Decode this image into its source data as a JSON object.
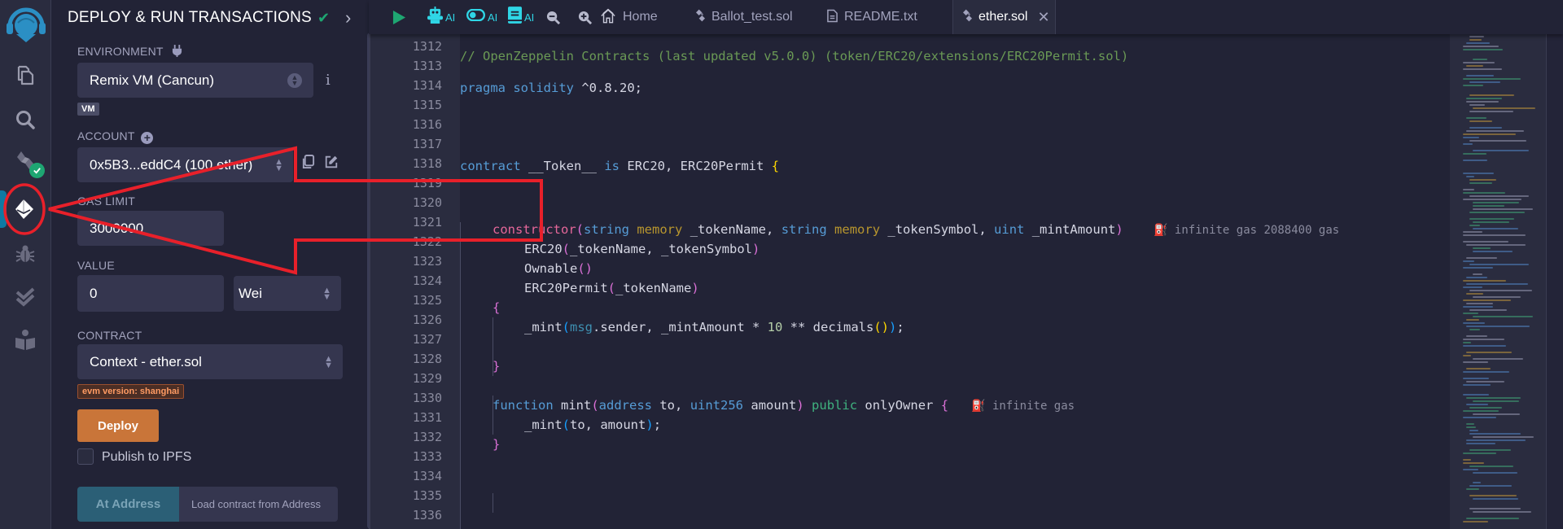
{
  "side_panel": {
    "title": "DEPLOY & RUN TRANSACTIONS",
    "environment": {
      "label": "ENVIRONMENT",
      "value": "Remix VM (Cancun)",
      "badge": "VM",
      "info": "i"
    },
    "account": {
      "label": "ACCOUNT",
      "value": "0x5B3...eddC4 (100 ether)"
    },
    "gas_limit": {
      "label": "GAS LIMIT",
      "value": "3000000"
    },
    "value": {
      "label": "VALUE",
      "amount": "0",
      "unit": "Wei"
    },
    "contract": {
      "label": "CONTRACT",
      "value": "Context - ether.sol",
      "evm_badge": "evm version: shanghai"
    },
    "deploy_label": "Deploy",
    "publish_ipfs_label": "Publish to IPFS",
    "publish_ipfs_checked": false,
    "at_address_label": "At Address",
    "at_address_placeholder": "Load contract from Address"
  },
  "icon_rail": {
    "items": [
      {
        "icon": "remix-logo-icon"
      },
      {
        "icon": "file-explorer-icon"
      },
      {
        "icon": "search-icon"
      },
      {
        "icon": "solidity-compiler-icon",
        "badge": "success-check"
      },
      {
        "icon": "deploy-run-icon",
        "active": true
      },
      {
        "icon": "debugger-icon"
      },
      {
        "icon": "testing-icon"
      },
      {
        "icon": "learneth-icon"
      }
    ]
  },
  "toolbar": {
    "run_icon": "play-icon",
    "ai_buttons": [
      {
        "icon": "robot-icon",
        "label": "AI"
      },
      {
        "icon": "toggle-icon",
        "label": "AI"
      },
      {
        "icon": "book-icon",
        "label": "AI"
      }
    ],
    "zoom_out_icon": "zoom-out-icon",
    "zoom_in_icon": "zoom-in-icon"
  },
  "tabs": [
    {
      "label": "Home",
      "icon": "home-icon",
      "active": false
    },
    {
      "label": "Ballot_test.sol",
      "icon": "solidity-file-icon",
      "active": false
    },
    {
      "label": "README.txt",
      "icon": "text-file-icon",
      "active": false
    },
    {
      "label": "ether.sol",
      "icon": "solidity-file-icon",
      "active": true,
      "closable": true
    }
  ],
  "editor": {
    "line_numbers": [
      "1312",
      "1313",
      "1314",
      "1315",
      "1316",
      "1317",
      "1318",
      "1319",
      "1320",
      "1321",
      "1322",
      "1323",
      "1324",
      "1325",
      "1326",
      "1327",
      "1328",
      "1329",
      "1330",
      "1331",
      "1332",
      "1333",
      "1334",
      "1335",
      "1336"
    ],
    "lines": {
      "l1313_comment": "// OpenZeppelin Contracts (last updated v5.0.0) (token/ERC20/extensions/ERC20Permit.sol)",
      "l1315_pragma": "pragma",
      "l1315_solidity": "solidity",
      "l1315_version": "^0.8.20;",
      "l1320_contract": "contract",
      "l1320_name": "__Token__",
      "l1320_is": "is",
      "l1320_bases": "ERC20, ERC20Permit",
      "l1320_brace": "{",
      "l1324_ctor": "constructor",
      "l1324_p_open": "(",
      "l1324_string1": "string",
      "l1324_memory1": "memory",
      "l1324_arg1": "_tokenName,",
      "l1324_string2": "string",
      "l1324_memory2": "memory",
      "l1324_arg2": "_tokenSymbol,",
      "l1324_uint": "uint",
      "l1324_arg3": "_mintAmount",
      "l1324_p_close": ")",
      "l1324_gas": "infinite gas 2088400 gas",
      "l1325_a": "ERC20",
      "l1325_b": "(",
      "l1325_c": "_tokenName, _tokenSymbol",
      "l1325_d": ")",
      "l1326_a": "Ownable",
      "l1326_b": "()",
      "l1327_a": "ERC20Permit",
      "l1327_b": "(",
      "l1327_c": "_tokenName",
      "l1327_d": ")",
      "l1328": "{",
      "l1329_a": "_mint",
      "l1329_b": "(",
      "l1329_msg": "msg",
      "l1329_c": ".sender, _mintAmount * ",
      "l1329_num": "10",
      "l1329_d": " ** decimals",
      "l1329_e": "()",
      "l1329_f": ")",
      "l1329_g": ";",
      "l1331": "}",
      "l1333_function": "function",
      "l1333_name": "mint",
      "l1333_p_open": "(",
      "l1333_address": "address",
      "l1333_to": "to,",
      "l1333_uint256": "uint256",
      "l1333_amount": "amount",
      "l1333_p_close": ")",
      "l1333_public": "public",
      "l1333_only": "onlyOwner",
      "l1333_brace": "{",
      "l1333_gas": "infinite gas",
      "l1334_a": "_mint",
      "l1334_b": "(",
      "l1334_c": "to, amount",
      "l1334_d": ")",
      "l1334_e": ";",
      "l1335": "}"
    }
  },
  "annotation": {
    "color": "#e8202a",
    "shape": "arrow pointing to deploy-run icon, circled"
  },
  "colors": {
    "accent_green": "#1ea672",
    "deploy_orange": "#c97539",
    "active_bar_blue": "#0e7aa3",
    "ai_cyan": "#2fd6e6"
  }
}
